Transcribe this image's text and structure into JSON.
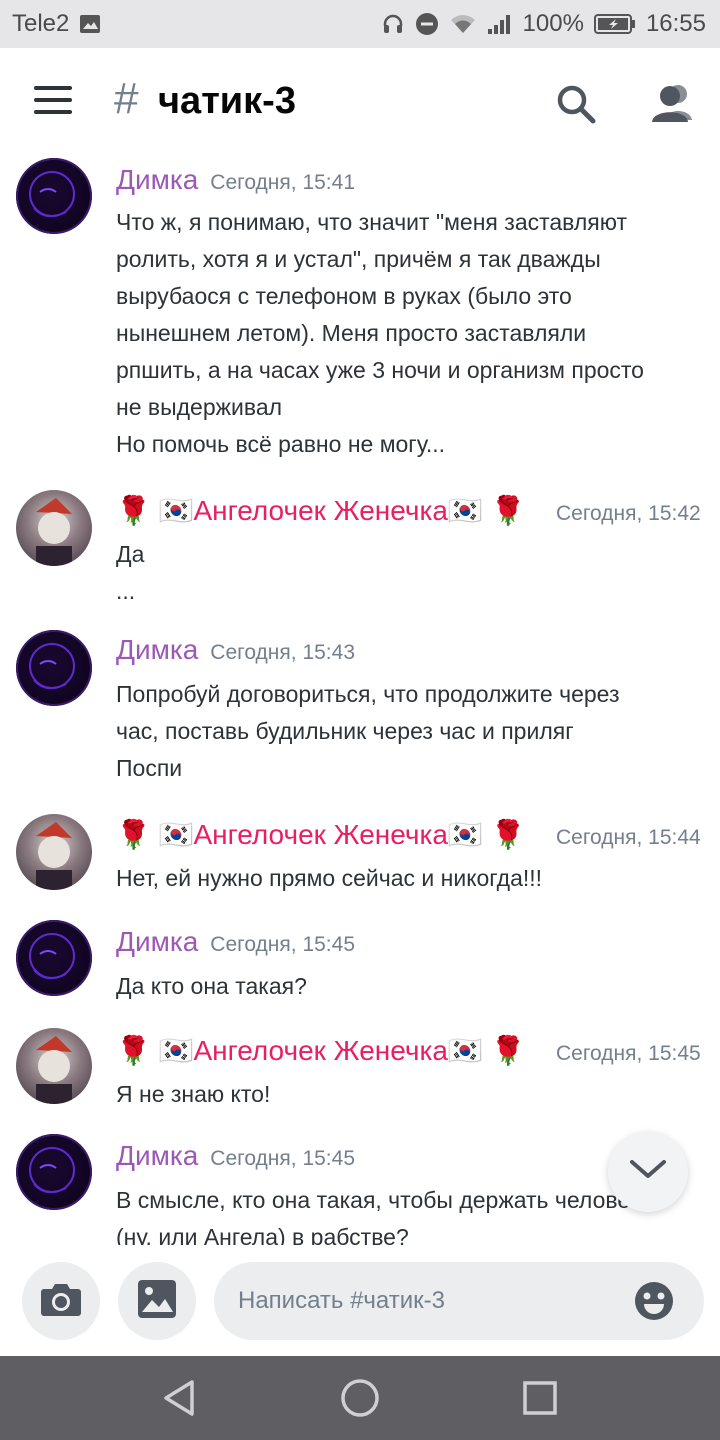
{
  "status_bar": {
    "carrier": "Tele2",
    "battery": "100%",
    "time": "16:55"
  },
  "header": {
    "hash": "#",
    "channel": "чатик-3"
  },
  "messages": [
    {
      "author": "Димка",
      "author_type": "dimka",
      "time": "Сегодня, 15:41",
      "text": "Что ж, я понимаю, что значит \"меня заставляют\nролить, хотя я и устал\", причём я так дважды\nвырубаося с телефоном в руках (было это\nнынешнем летом). Меня просто заставляли\nрпшить, а на часах уже 3 ночи и организм просто\nне выдерживал\nНо помочь всё равно не могу..."
    },
    {
      "author": "🌹 🇰🇷Ангелочек Женечка🇰🇷 🌹",
      "author_type": "angel",
      "time": "Сегодня, 15:42",
      "text": "Да\n..."
    },
    {
      "author": "Димка",
      "author_type": "dimka",
      "time": "Сегодня, 15:43",
      "text": "Попробуй договориться, что продолжите через\nчас, поставь будильник через час и приляг\nПоспи"
    },
    {
      "author": "🌹 🇰🇷Ангелочек Женечка🇰🇷 🌹",
      "author_type": "angel",
      "time": "Сегодня, 15:44",
      "text": "Нет, ей нужно прямо сейчас и никогда!!!"
    },
    {
      "author": "Димка",
      "author_type": "dimka",
      "time": "Сегодня, 15:45",
      "text": "Да кто она такая?"
    },
    {
      "author": "🌹 🇰🇷Ангелочек Женечка🇰🇷 🌹",
      "author_type": "angel",
      "time": "Сегодня, 15:45",
      "text": "Я не знаю кто!"
    },
    {
      "author": "Димка",
      "author_type": "dimka",
      "time": "Сегодня, 15:45",
      "text": "В смысле, кто она такая, чтобы держать человека\n(ну, или Ангела) в рабстве?"
    }
  ],
  "composer": {
    "placeholder": "Написать #чатик-3"
  },
  "colors": {
    "dimka_name": "#9b59b6",
    "angel_name": "#e91e63",
    "timestamp": "#747f8d",
    "text": "#2e3338"
  },
  "icons": {
    "menu": "menu-icon",
    "search": "search-icon",
    "members": "members-icon",
    "camera": "camera-icon",
    "gallery": "image-icon",
    "emoji": "emoji-icon",
    "scroll_down": "chevron-down-icon",
    "nav_back": "back-triangle-icon",
    "nav_home": "home-circle-icon",
    "nav_recents": "recents-square-icon"
  }
}
